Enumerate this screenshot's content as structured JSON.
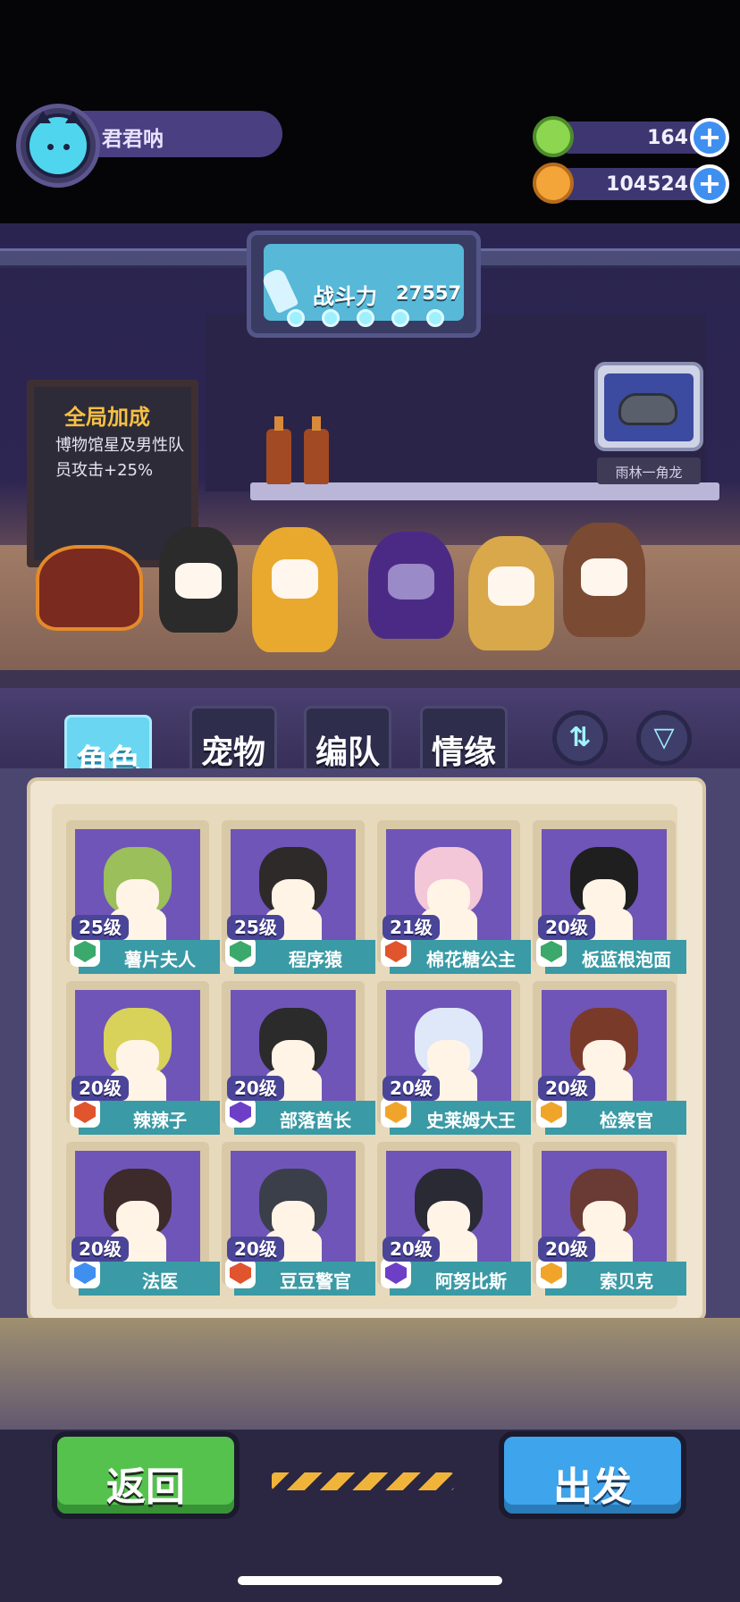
{
  "player": {
    "name": "君君呐"
  },
  "currencies": [
    {
      "name": "gem",
      "value": "164",
      "color": "#8dd64f"
    },
    {
      "name": "coin",
      "value": "104524",
      "color": "#f3a53a"
    }
  ],
  "power": {
    "label": "战斗力",
    "value": "27557",
    "stars": 5
  },
  "bonus_board": {
    "title": "全局加成",
    "text": "博物馆星及男性队员攻击+25%"
  },
  "showcase": {
    "label": "雨林一角龙"
  },
  "tabs": [
    {
      "label": "角色",
      "active": true
    },
    {
      "label": "宠物",
      "active": false
    },
    {
      "label": "编队",
      "active": false
    },
    {
      "label": "情缘",
      "active": false
    }
  ],
  "tool_buttons": {
    "swap_icon": "swap-icon",
    "filter_icon": "filter-icon"
  },
  "characters": [
    {
      "level": "25级",
      "name": "薯片夫人",
      "class_color": "#3aa96b"
    },
    {
      "level": "25级",
      "name": "程序猿",
      "class_color": "#3aa96b"
    },
    {
      "level": "21级",
      "name": "棉花糖公主",
      "class_color": "#e0542e"
    },
    {
      "level": "20级",
      "name": "板蓝根泡面",
      "class_color": "#3aa96b"
    },
    {
      "level": "20级",
      "name": "辣辣子",
      "class_color": "#e0542e"
    },
    {
      "level": "20级",
      "name": "部落酋长",
      "class_color": "#6d3fc7"
    },
    {
      "level": "20级",
      "name": "史莱姆大王",
      "class_color": "#f0a52a"
    },
    {
      "level": "20级",
      "name": "检察官",
      "class_color": "#f0a52a"
    },
    {
      "level": "20级",
      "name": "法医",
      "class_color": "#3f8ff0"
    },
    {
      "level": "20级",
      "name": "豆豆警官",
      "class_color": "#e0542e"
    },
    {
      "level": "20级",
      "name": "阿努比斯",
      "class_color": "#6d3fc7"
    },
    {
      "level": "20级",
      "name": "索贝克",
      "class_color": "#f0a52a"
    }
  ],
  "buttons": {
    "back": "返回",
    "go": "出发"
  }
}
